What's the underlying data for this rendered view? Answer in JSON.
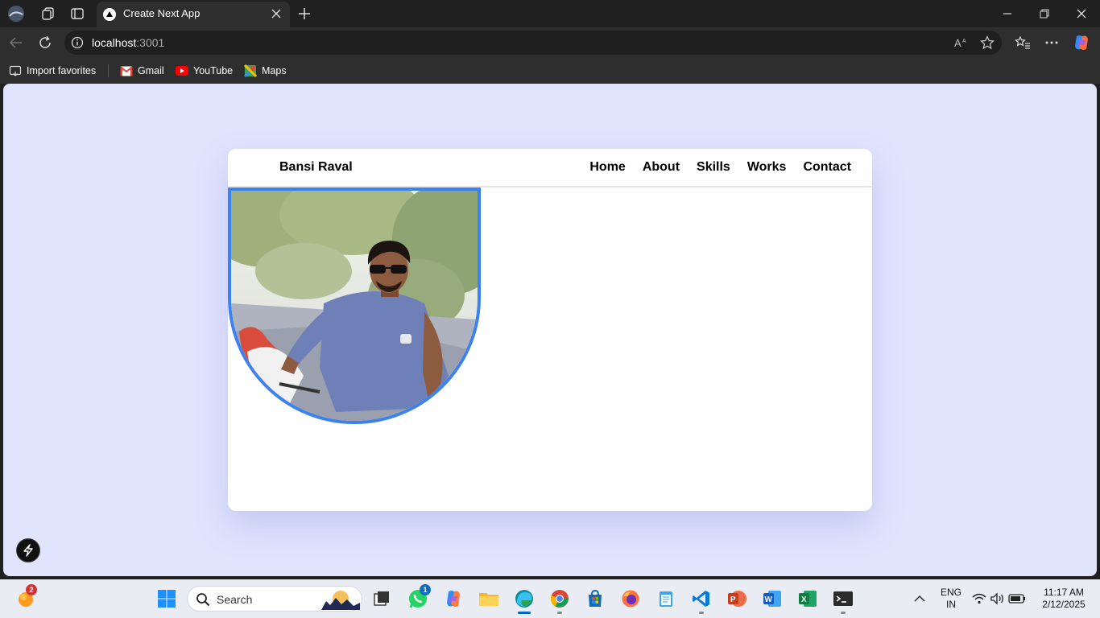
{
  "browser": {
    "tab_title": "Create Next App",
    "address_host": "localhost",
    "address_port": ":3001",
    "favorites": [
      {
        "label": "Import favorites",
        "icon": "import-icon"
      },
      {
        "label": "Gmail",
        "icon": "gmail-icon"
      },
      {
        "label": "YouTube",
        "icon": "youtube-icon"
      },
      {
        "label": "Maps",
        "icon": "maps-icon"
      }
    ]
  },
  "page": {
    "brand": "Bansi Raval",
    "nav": [
      "Home",
      "About",
      "Skills",
      "Works",
      "Contact"
    ],
    "accent": "#3b82f0",
    "background": "#e1e4fd"
  },
  "taskbar": {
    "search_placeholder": "Search",
    "lang_line1": "ENG",
    "lang_line2": "IN",
    "time": "11:17 AM",
    "date": "2/12/2025",
    "weather_badge": "2",
    "whatsapp_badge": "1"
  }
}
